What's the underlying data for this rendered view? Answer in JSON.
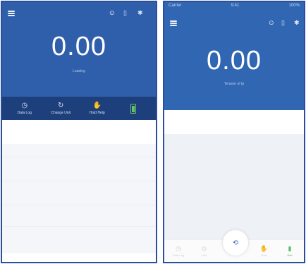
{
  "left_screen": {
    "reading": "0.00",
    "sub_label": "Loading",
    "header_icons": [
      "history-icon",
      "device-icon",
      "bluetooth-icon"
    ],
    "toolbar": [
      {
        "icon": "clock-icon",
        "glyph": "◷",
        "label": "Data Log"
      },
      {
        "icon": "unit-icon",
        "glyph": "↻",
        "label": "Change Unit"
      },
      {
        "icon": "hand-icon",
        "glyph": "✋",
        "label": "Hold Help"
      }
    ],
    "battery": {
      "level": 0.6,
      "color": "#66c26b"
    }
  },
  "right_screen": {
    "status": {
      "carrier": "Carrier",
      "time": "9:41",
      "right": "100%"
    },
    "reading": "0.00",
    "sub_label": "Tension of tp",
    "header_icons": [
      "history-icon",
      "device-icon",
      "bluetooth-icon"
    ],
    "bottom_nav": [
      {
        "icon": "clock-icon",
        "glyph": "◷",
        "label": "Data Log"
      },
      {
        "icon": "unit-icon",
        "glyph": "⊙",
        "label": "Unit"
      },
      {
        "icon": "hand-icon",
        "glyph": "✋",
        "label": "Hold"
      },
      {
        "icon": "battery-icon",
        "glyph": "▮",
        "label": "Batt"
      }
    ],
    "fab_glyph": "⟲"
  },
  "colors": {
    "header": "#2f5fab",
    "toolbar": "#1d3f7c",
    "accent_green": "#5cbf66"
  }
}
